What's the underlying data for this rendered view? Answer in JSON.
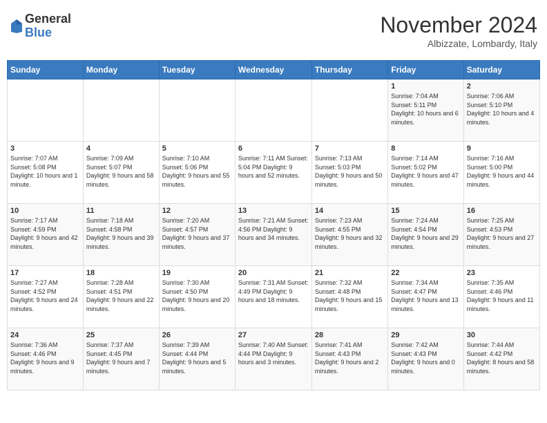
{
  "logo": {
    "general": "General",
    "blue": "Blue"
  },
  "header": {
    "month": "November 2024",
    "location": "Albizzate, Lombardy, Italy"
  },
  "days_of_week": [
    "Sunday",
    "Monday",
    "Tuesday",
    "Wednesday",
    "Thursday",
    "Friday",
    "Saturday"
  ],
  "weeks": [
    [
      {
        "day": "",
        "info": ""
      },
      {
        "day": "",
        "info": ""
      },
      {
        "day": "",
        "info": ""
      },
      {
        "day": "",
        "info": ""
      },
      {
        "day": "",
        "info": ""
      },
      {
        "day": "1",
        "info": "Sunrise: 7:04 AM\nSunset: 5:11 PM\nDaylight: 10 hours and 6 minutes."
      },
      {
        "day": "2",
        "info": "Sunrise: 7:06 AM\nSunset: 5:10 PM\nDaylight: 10 hours and 4 minutes."
      }
    ],
    [
      {
        "day": "3",
        "info": "Sunrise: 7:07 AM\nSunset: 5:08 PM\nDaylight: 10 hours and 1 minute."
      },
      {
        "day": "4",
        "info": "Sunrise: 7:09 AM\nSunset: 5:07 PM\nDaylight: 9 hours and 58 minutes."
      },
      {
        "day": "5",
        "info": "Sunrise: 7:10 AM\nSunset: 5:06 PM\nDaylight: 9 hours and 55 minutes."
      },
      {
        "day": "6",
        "info": "Sunrise: 7:11 AM\nSunset: 5:04 PM\nDaylight: 9 hours and 52 minutes."
      },
      {
        "day": "7",
        "info": "Sunrise: 7:13 AM\nSunset: 5:03 PM\nDaylight: 9 hours and 50 minutes."
      },
      {
        "day": "8",
        "info": "Sunrise: 7:14 AM\nSunset: 5:02 PM\nDaylight: 9 hours and 47 minutes."
      },
      {
        "day": "9",
        "info": "Sunrise: 7:16 AM\nSunset: 5:00 PM\nDaylight: 9 hours and 44 minutes."
      }
    ],
    [
      {
        "day": "10",
        "info": "Sunrise: 7:17 AM\nSunset: 4:59 PM\nDaylight: 9 hours and 42 minutes."
      },
      {
        "day": "11",
        "info": "Sunrise: 7:18 AM\nSunset: 4:58 PM\nDaylight: 9 hours and 39 minutes."
      },
      {
        "day": "12",
        "info": "Sunrise: 7:20 AM\nSunset: 4:57 PM\nDaylight: 9 hours and 37 minutes."
      },
      {
        "day": "13",
        "info": "Sunrise: 7:21 AM\nSunset: 4:56 PM\nDaylight: 9 hours and 34 minutes."
      },
      {
        "day": "14",
        "info": "Sunrise: 7:23 AM\nSunset: 4:55 PM\nDaylight: 9 hours and 32 minutes."
      },
      {
        "day": "15",
        "info": "Sunrise: 7:24 AM\nSunset: 4:54 PM\nDaylight: 9 hours and 29 minutes."
      },
      {
        "day": "16",
        "info": "Sunrise: 7:25 AM\nSunset: 4:53 PM\nDaylight: 9 hours and 27 minutes."
      }
    ],
    [
      {
        "day": "17",
        "info": "Sunrise: 7:27 AM\nSunset: 4:52 PM\nDaylight: 9 hours and 24 minutes."
      },
      {
        "day": "18",
        "info": "Sunrise: 7:28 AM\nSunset: 4:51 PM\nDaylight: 9 hours and 22 minutes."
      },
      {
        "day": "19",
        "info": "Sunrise: 7:30 AM\nSunset: 4:50 PM\nDaylight: 9 hours and 20 minutes."
      },
      {
        "day": "20",
        "info": "Sunrise: 7:31 AM\nSunset: 4:49 PM\nDaylight: 9 hours and 18 minutes."
      },
      {
        "day": "21",
        "info": "Sunrise: 7:32 AM\nSunset: 4:48 PM\nDaylight: 9 hours and 15 minutes."
      },
      {
        "day": "22",
        "info": "Sunrise: 7:34 AM\nSunset: 4:47 PM\nDaylight: 9 hours and 13 minutes."
      },
      {
        "day": "23",
        "info": "Sunrise: 7:35 AM\nSunset: 4:46 PM\nDaylight: 9 hours and 11 minutes."
      }
    ],
    [
      {
        "day": "24",
        "info": "Sunrise: 7:36 AM\nSunset: 4:46 PM\nDaylight: 9 hours and 9 minutes."
      },
      {
        "day": "25",
        "info": "Sunrise: 7:37 AM\nSunset: 4:45 PM\nDaylight: 9 hours and 7 minutes."
      },
      {
        "day": "26",
        "info": "Sunrise: 7:39 AM\nSunset: 4:44 PM\nDaylight: 9 hours and 5 minutes."
      },
      {
        "day": "27",
        "info": "Sunrise: 7:40 AM\nSunset: 4:44 PM\nDaylight: 9 hours and 3 minutes."
      },
      {
        "day": "28",
        "info": "Sunrise: 7:41 AM\nSunset: 4:43 PM\nDaylight: 9 hours and 2 minutes."
      },
      {
        "day": "29",
        "info": "Sunrise: 7:42 AM\nSunset: 4:43 PM\nDaylight: 9 hours and 0 minutes."
      },
      {
        "day": "30",
        "info": "Sunrise: 7:44 AM\nSunset: 4:42 PM\nDaylight: 8 hours and 58 minutes."
      }
    ]
  ]
}
